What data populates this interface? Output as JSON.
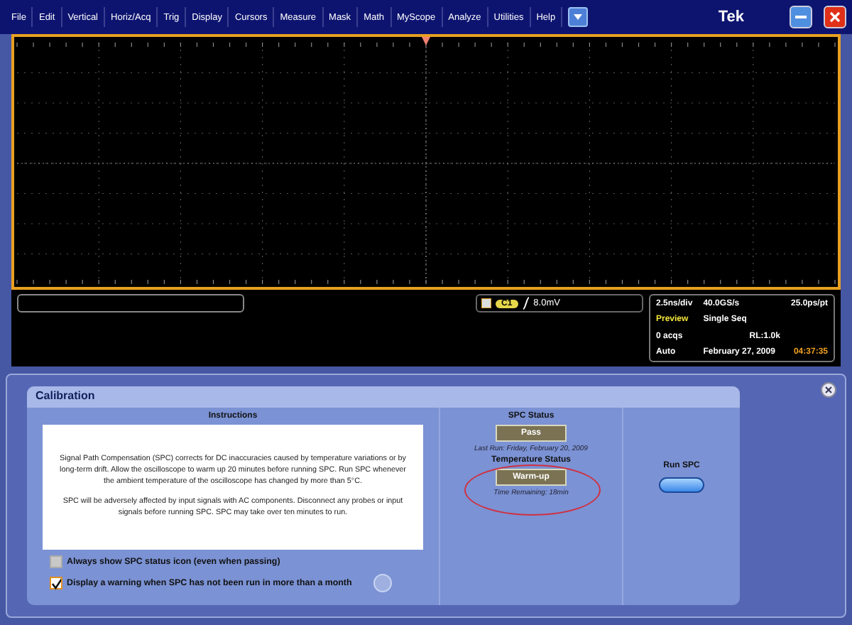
{
  "menu_bar": {
    "items": [
      "File",
      "Edit",
      "Vertical",
      "Horiz/Acq",
      "Trig",
      "Display",
      "Cursors",
      "Measure",
      "Mask",
      "Math",
      "MyScope",
      "Analyze",
      "Utilities",
      "Help"
    ],
    "brand": "Tek"
  },
  "readout": {
    "trigger_source": "C1",
    "trigger_level": "8.0mV",
    "rows": [
      [
        "2.5ns/div",
        "40.0GS/s",
        "25.0ps/pt"
      ],
      [
        "Preview",
        "Single Seq"
      ],
      [
        "0 acqs",
        "RL:1.0k"
      ],
      [
        "Auto",
        "February 27, 2009",
        "04:37:35"
      ]
    ]
  },
  "calibration": {
    "title": "Calibration",
    "instructions_heading": "Instructions",
    "paragraphs": [
      "Signal Path Compensation (SPC) corrects for DC inaccuracies caused by temperature variations or by long-term drift. Allow the oscilloscope to warm up 20 minutes before running SPC. Run SPC whenever the ambient temperature of the oscilloscope has changed by more than 5°C.",
      "SPC will be adversely affected by input signals with AC components. Disconnect any probes or input signals before running SPC. SPC may take over ten minutes to run."
    ],
    "options": [
      {
        "label": "Always show SPC status icon (even when passing)",
        "checked": false
      },
      {
        "label": "Display a warning when SPC has not been run in more than a month",
        "checked": true
      }
    ],
    "spc_status": {
      "heading": "SPC Status",
      "value": "Pass",
      "note": "Last Run: Friday, February 20, 2009"
    },
    "temperature_status": {
      "heading": "Temperature Status",
      "value": "Warm-up",
      "note": "Time Remaining: 18min"
    },
    "run_label": "Run SPC"
  }
}
